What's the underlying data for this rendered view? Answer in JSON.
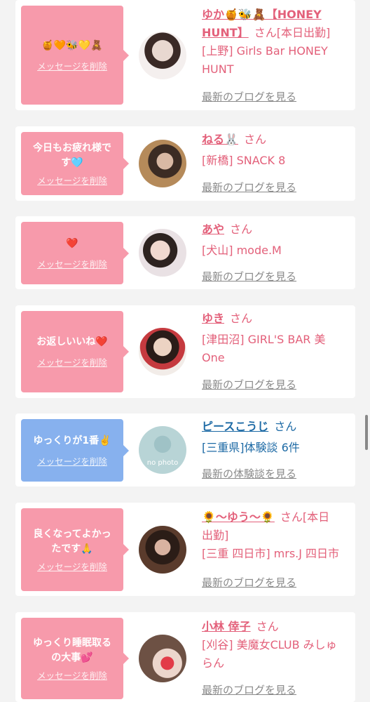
{
  "cards": [
    {
      "message": "🍯🧡🐝💛🧸",
      "delete_label": "メッセージを削除",
      "name_line1": "ゆか🍯🐝🧸【HONEY",
      "name_line2": "HUNT】",
      "san": "さん",
      "name_suffix": "[本日出勤]",
      "shop_line1": "[上野] Girls Bar HONEY",
      "shop_line2": "HUNT",
      "link": "最新のブログを見る"
    },
    {
      "message_line1": "今日もお疲れ様で",
      "message_line2": "す🩵",
      "delete_label": "メッセージを削除",
      "name": "ねる🐰",
      "san": "さん",
      "shop": "[新橋] SNACK 8",
      "link": "最新のブログを見る"
    },
    {
      "message": "❤️",
      "delete_label": "メッセージを削除",
      "name": "あや",
      "san": "さん",
      "shop": "[犬山] mode.M",
      "link": "最新のブログを見る"
    },
    {
      "message": "お返しいいね❤️",
      "delete_label": "メッセージを削除",
      "name": "ゆき",
      "san": "さん",
      "shop_line1": "[津田沼] GIRL'S BAR 美",
      "shop_line2": "One",
      "link": "最新のブログを見る"
    },
    {
      "message": "ゆっくりが1番✌️",
      "delete_label": "メッセージを削除",
      "name": "ピースこうじ",
      "san": "さん",
      "shop": "[三重県]体験談 6件",
      "link": "最新の体験談を見る",
      "avatar_text": "no photo"
    },
    {
      "message_line1": "良くなってよかっ",
      "message_line2": "たです🙏",
      "delete_label": "メッセージを削除",
      "name": "🌻〜ゆう〜🌻",
      "san": "さん",
      "name_suffix": "[本日",
      "name_line2": "出勤]",
      "shop": "[三重 四日市] mrs.J 四日市",
      "link": "最新のブログを見る"
    },
    {
      "message_line1": "ゆっくり睡眠取る",
      "message_line2": "の大事💕",
      "delete_label": "メッセージを削除",
      "name": "小林 倖子",
      "san": "さん",
      "shop_line1": "[刈谷] 美魔女CLUB みしゅ",
      "shop_line2": "らん",
      "link": "最新のブログを見る"
    }
  ],
  "colors": {
    "pink_bubble": "#f79aab",
    "blue_bubble": "#87b1ee",
    "pink_text": "#e3607a",
    "blue_text": "#1d6aa5",
    "link_gray": "#8a8a8a"
  }
}
